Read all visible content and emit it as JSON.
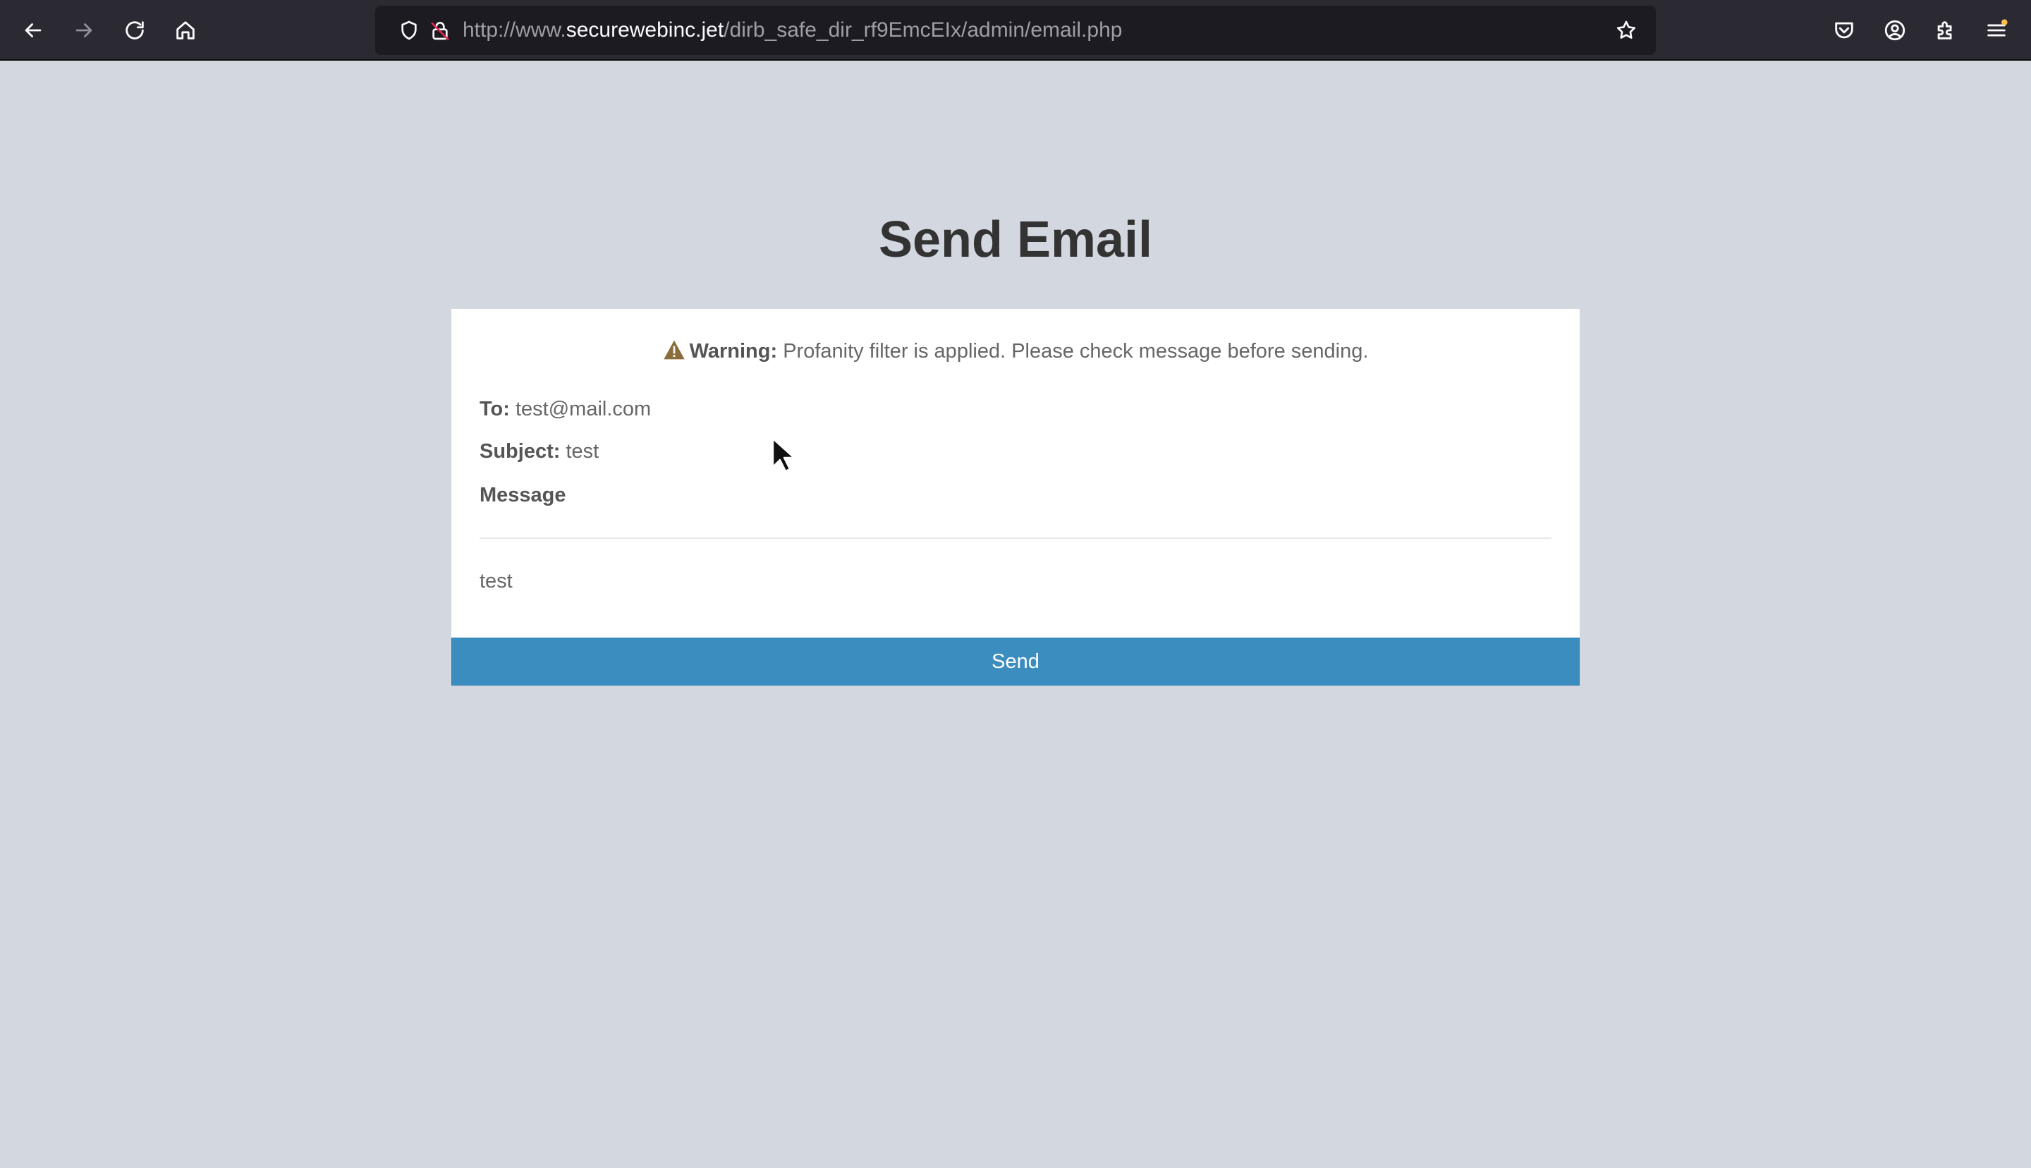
{
  "browser": {
    "url_scheme": "http://www.",
    "url_host": "securewebinc.jet",
    "url_path": "/dirb_safe_dir_rf9EmcEIx/admin/email.php"
  },
  "page": {
    "title": "Send Email"
  },
  "warning": {
    "label": "Warning:",
    "text": " Profanity filter is applied. Please check message before sending."
  },
  "email": {
    "to_label": "To:",
    "to_value": " test@mail.com",
    "subject_label": "Subject:",
    "subject_value": " test",
    "message_label": "Message",
    "message_body": "test"
  },
  "actions": {
    "send_label": "Send"
  },
  "colors": {
    "page_bg": "#d3d7e0",
    "toolbar_bg": "#2b2a33",
    "send_button": "#3b8dc0",
    "warning_icon": "#8a6d3b"
  }
}
